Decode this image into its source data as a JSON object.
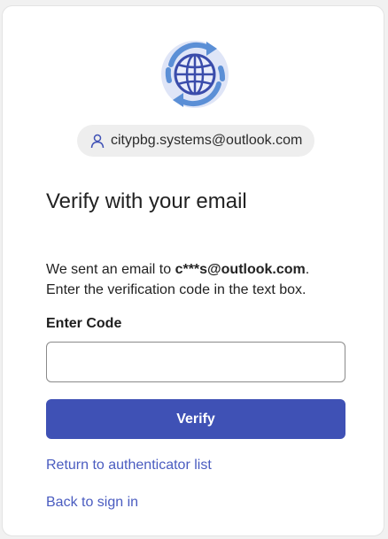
{
  "identity": {
    "email": "citypbg.systems@outlook.com"
  },
  "main": {
    "title": "Verify with your email",
    "message_prefix": "We sent an email to ",
    "masked_email": "c***s@outlook.com",
    "message_suffix": ".",
    "message_line2": "Enter the verification code in the text box.",
    "code_label": "Enter Code",
    "code_value": "",
    "verify_label": "Verify",
    "link_authenticator": "Return to authenticator list",
    "link_signin": "Back to sign in"
  },
  "colors": {
    "primary": "#3f51b5",
    "link": "#4a5cc0",
    "logo_ring": "#5b8fd6",
    "logo_globe": "#3a4cab"
  },
  "icons": {
    "logo": "globe-sync-icon",
    "user": "user-icon"
  }
}
